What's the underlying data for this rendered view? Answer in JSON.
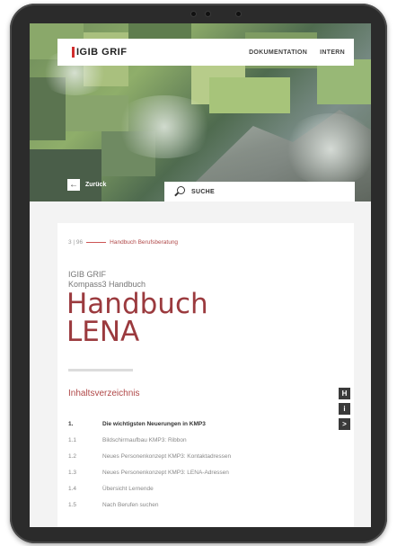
{
  "header": {
    "logo": "IGIB GRIF",
    "nav": [
      "DOKUMENTATION",
      "INTERN"
    ]
  },
  "back_label": "Zurück",
  "search": {
    "label": "SUCHE"
  },
  "breadcrumb": {
    "page": "3 | 96",
    "title": "Handbuch Berufsberatung"
  },
  "subtitle_1": "IGIB GRIF",
  "subtitle_2": "Kompass3 Handbuch",
  "title_line_1": "Handbuch",
  "title_line_2": "LENA",
  "toc": {
    "heading": "Inhaltsverzeichnis",
    "items": [
      {
        "num": "1.",
        "text": "Die wichtigsten Neuerungen in KMP3"
      },
      {
        "num": "1.1",
        "text": "Bildschirmaufbau KMP3: Ribbon"
      },
      {
        "num": "1.2",
        "text": "Neues Personenkonzept KMP3: Kontaktadressen"
      },
      {
        "num": "1.3",
        "text": "Neues Personenkonzept KMP3: LENA-Adressen"
      },
      {
        "num": "1.4",
        "text": "Übersicht Lernende"
      },
      {
        "num": "1.5",
        "text": "Nach Berufen suchen"
      }
    ]
  },
  "side_buttons": [
    "H",
    "i",
    ">"
  ],
  "colors": {
    "accent": "#9b3a3e",
    "frame": "#2b2b2b"
  }
}
